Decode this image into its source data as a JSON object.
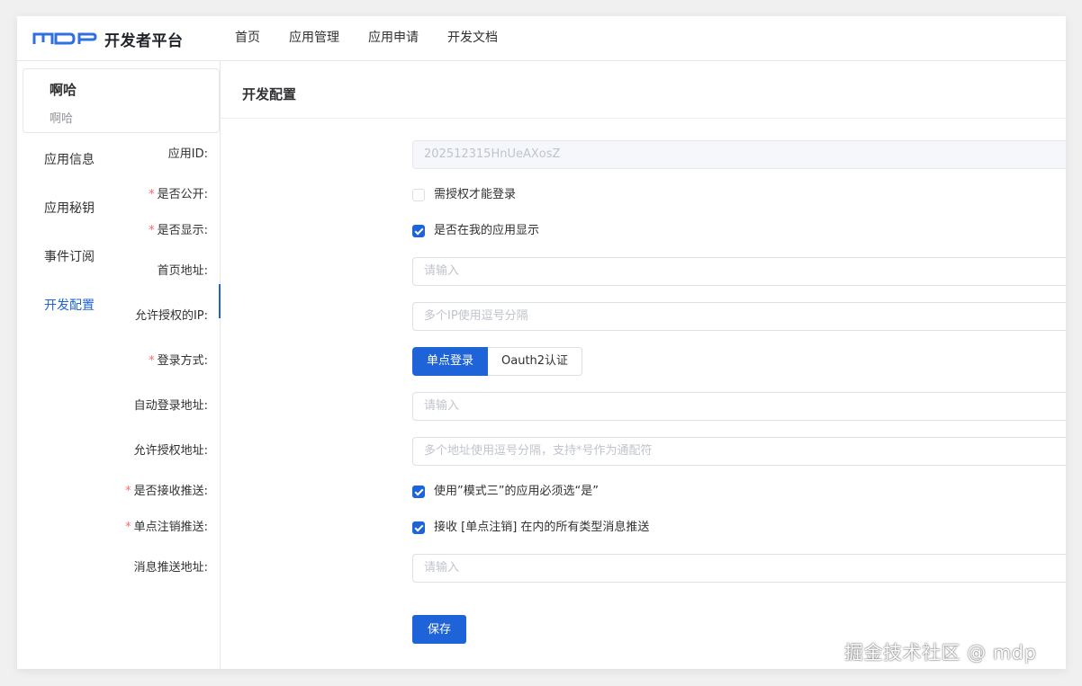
{
  "header": {
    "logo_text": "MDP",
    "title": "开发者平台",
    "nav": [
      "首页",
      "应用管理",
      "应用申请",
      "开发文档"
    ]
  },
  "sidebar": {
    "app_name": "啊哈",
    "app_sub": "啊哈",
    "items": [
      {
        "label": "应用信息",
        "active": false
      },
      {
        "label": "应用秘钥",
        "active": false
      },
      {
        "label": "事件订阅",
        "active": false
      },
      {
        "label": "开发配置",
        "active": true
      }
    ]
  },
  "main": {
    "title": "开发配置",
    "fields": {
      "app_id": {
        "label": "应用ID:",
        "value": "202512315HnUeAXosZ"
      },
      "is_public": {
        "label": "是否公开:",
        "checkbox_label": "需授权才能登录",
        "checked": false
      },
      "is_show": {
        "label": "是否显示:",
        "checkbox_label": "是否在我的应用显示",
        "checked": true
      },
      "home_url": {
        "label": "首页地址:",
        "placeholder": "请输入"
      },
      "allow_ip": {
        "label": "允许授权的IP:",
        "placeholder": "多个IP使用逗号分隔"
      },
      "login_mode": {
        "label": "登录方式:",
        "options": [
          "单点登录",
          "Oauth2认证"
        ],
        "selected": "单点登录"
      },
      "auto_login_url": {
        "label": "自动登录地址:",
        "placeholder": "请输入"
      },
      "allow_auth_url": {
        "label": "允许授权地址:",
        "placeholder": "多个地址使用逗号分隔，支持*号作为通配符"
      },
      "receive_push": {
        "label": "是否接收推送:",
        "checkbox_label": "使用”模式三”的应用必须选“是”",
        "checked": true
      },
      "sso_logout_push": {
        "label": "单点注销推送:",
        "checkbox_label": "接收 [单点注销] 在内的所有类型消息推送",
        "checked": true
      },
      "push_url": {
        "label": "消息推送地址:",
        "placeholder": "请输入"
      }
    },
    "save_label": "保存"
  },
  "watermark": "掘金技术社区 @ mdp",
  "colors": {
    "primary": "#1e63d8",
    "required": "#f56c6c",
    "logo": "#2f6fe0"
  }
}
